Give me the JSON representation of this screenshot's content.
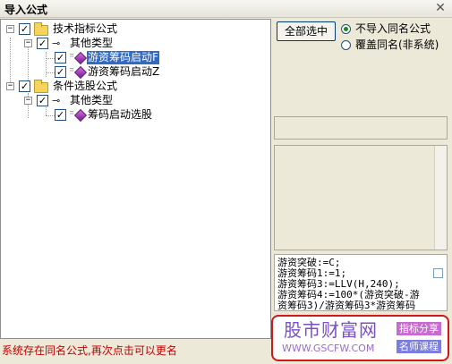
{
  "window": {
    "title": "导入公式",
    "close_glyph": "✕"
  },
  "tree": {
    "nodes": [
      {
        "label": "技术指标公式",
        "expander": "−",
        "checked": true
      },
      {
        "label": "其他类型",
        "expander": "−",
        "checked": true
      },
      {
        "label": "游资筹码启动F",
        "checked": true,
        "selected": true
      },
      {
        "label": "游资筹码启动Z",
        "checked": true
      },
      {
        "label": "条件选股公式",
        "expander": "−",
        "checked": true
      },
      {
        "label": "其他类型",
        "expander": "−",
        "checked": true
      },
      {
        "label": "筹码启动选股",
        "checked": true
      }
    ],
    "check_glyph": "✓"
  },
  "buttons": {
    "select_all": "全部选中"
  },
  "options": {
    "no_import_same_name": "不导入同名公式",
    "overwrite_same_name": "覆盖同名(非系统)",
    "selected": "no_import_same_name"
  },
  "code_preview": {
    "lines": [
      "游资突破:=C;",
      "游资筹码1:=1;",
      "游资筹码3:=LLV(H,240);",
      "游资筹码4:=100*(游资突破-游",
      "资筹码3)/游资筹码3*游资筹码"
    ]
  },
  "watermark": {
    "title": "股市财富网",
    "url": "WWW.GSCFW.COM",
    "tag1": "指标分享",
    "tag2": "名师课程"
  },
  "status": {
    "message": "系统存在同名公式,再次点击可以更名"
  },
  "colors": {
    "selection": "#316ac5",
    "status_text": "#c00000",
    "watermark_border": "#d01818",
    "watermark_title": "#7a4fc8"
  }
}
